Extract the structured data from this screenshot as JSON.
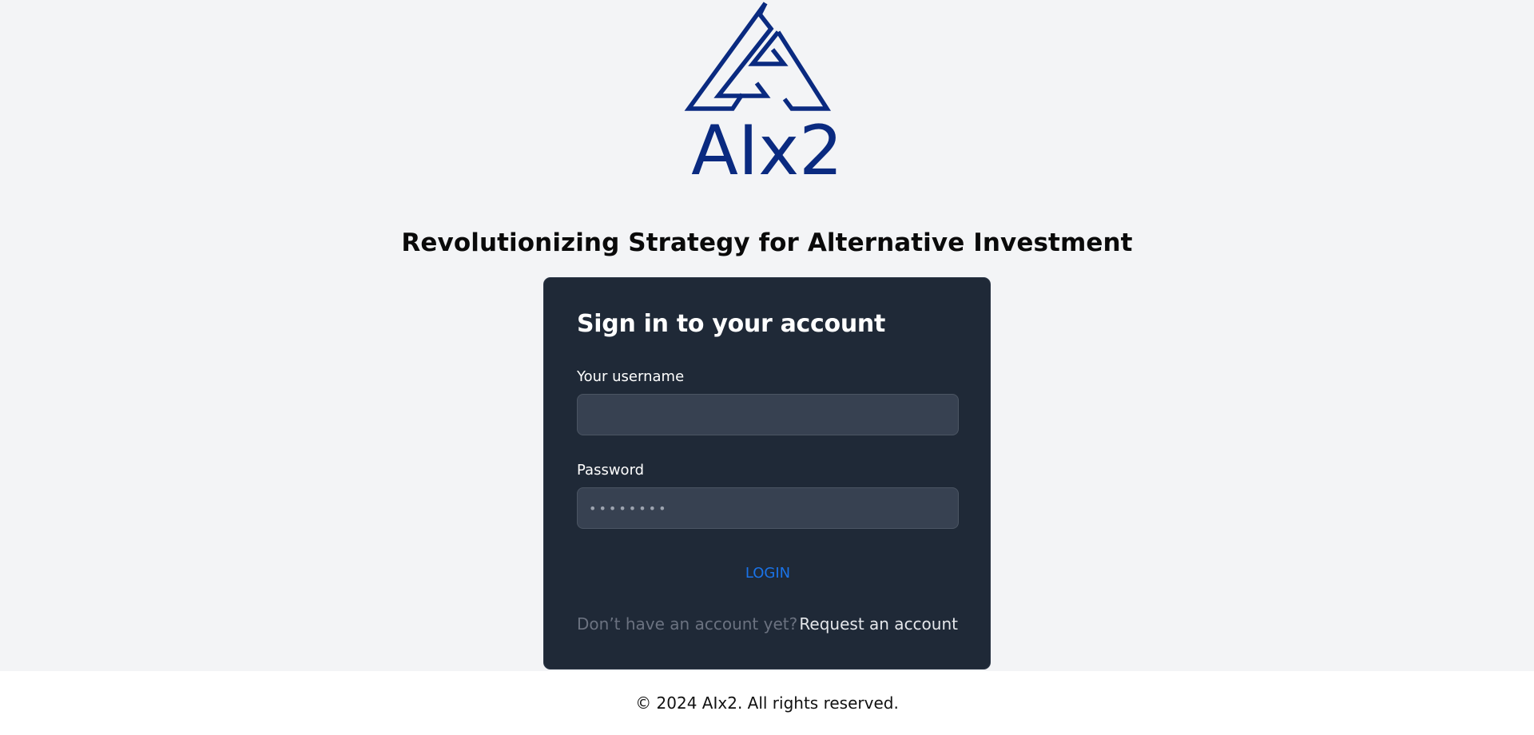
{
  "brand": {
    "name": "AIx2",
    "logo_icon": "aix2-triangle-logo-icon",
    "color": "#0a2a80"
  },
  "tagline": "Revolutionizing Strategy for Alternative Investment",
  "login_card": {
    "title": "Sign in to your account",
    "username": {
      "label": "Your username",
      "value": "",
      "placeholder": ""
    },
    "password": {
      "label": "Password",
      "value": "",
      "placeholder": "••••••••"
    },
    "login_label": "LOGIN",
    "no_account_text": "Don’t have an account yet?",
    "request_account_label": "Request an account"
  },
  "footer": {
    "copyright": "© 2024 AIx2. All rights reserved."
  },
  "colors": {
    "page_bg": "#f3f4f6",
    "card_bg": "#1f2937",
    "input_bg": "#374151",
    "link_blue": "#1a73e8",
    "brand_navy": "#0a2a80"
  }
}
